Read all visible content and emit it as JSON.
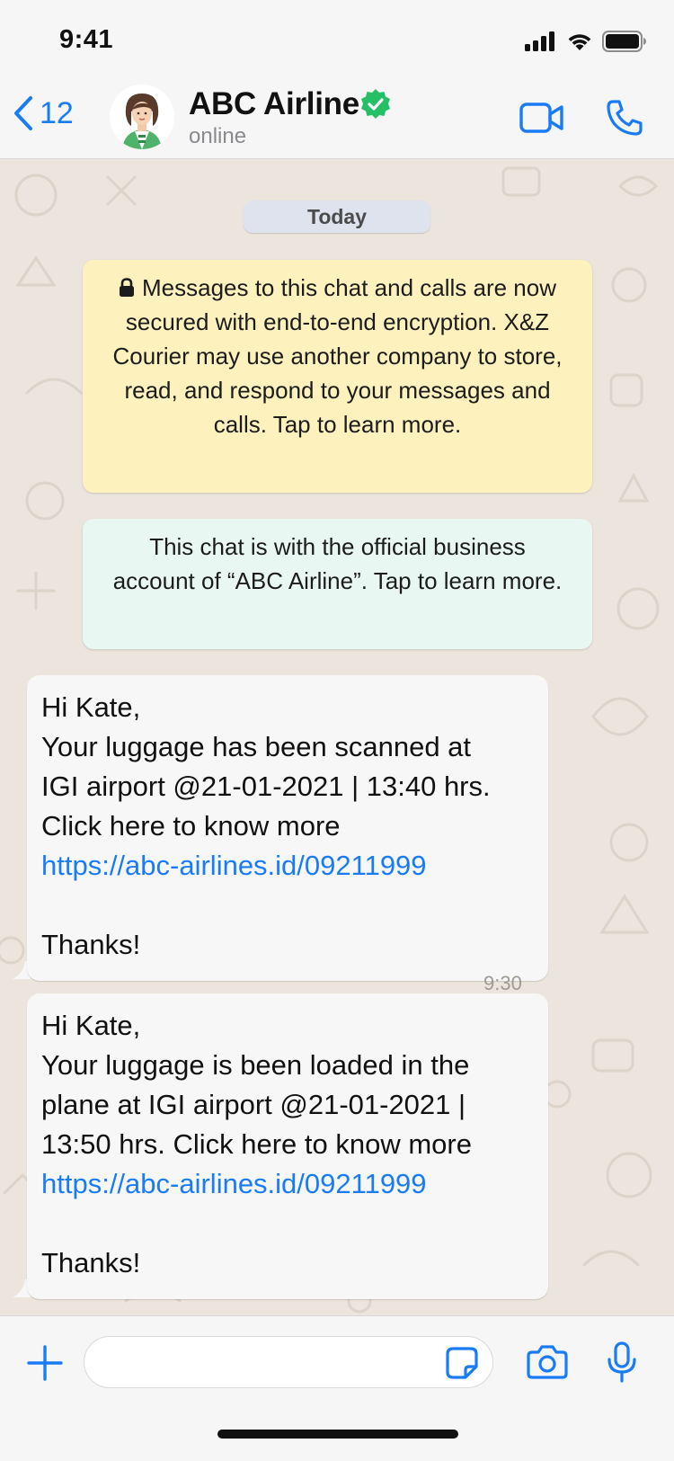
{
  "status_bar": {
    "time": "9:41"
  },
  "header": {
    "back_count": "12",
    "contact_name": "ABC Airline",
    "contact_status": "online"
  },
  "chat": {
    "date_label": "Today",
    "encryption_notice": "Messages to this chat and calls are now secured with end-to-end encryption. X&Z Courier may use another company to store, read, and respond to your messages and calls. Tap to learn more.",
    "business_notice": "This chat is with the official business account of “ABC Airline”. Tap to learn more.",
    "partial_time": "9:30",
    "messages": [
      {
        "greeting": "Hi Kate,",
        "body_lines": [
          "Your luggage has been scanned at",
          "IGI airport @21-01-2021 | 13:40 hrs.",
          "Click here to know more"
        ],
        "link": "https://abc-airlines.id/09211999",
        "closing": "Thanks!"
      },
      {
        "greeting": "Hi Kate,",
        "body_lines": [
          "Your luggage is been loaded in the",
          "plane at IGI airport @21-01-2021 |",
          "13:50 hrs. Click here to know more"
        ],
        "link": "https://abc-airlines.id/09211999",
        "closing": "Thanks!"
      }
    ]
  },
  "input": {
    "placeholder": ""
  },
  "icons": {
    "signal": "signal-icon",
    "wifi": "wifi-icon",
    "battery": "battery-icon",
    "back": "chevron-left-icon",
    "verified": "verified-badge-icon",
    "video": "video-call-icon",
    "phone": "phone-call-icon",
    "lock": "lock-icon",
    "plus": "plus-icon",
    "sticker": "sticker-icon",
    "camera": "camera-icon",
    "mic": "microphone-icon"
  },
  "colors": {
    "accent": "#1a7cf5",
    "verified": "#25c065",
    "encryption_notice_bg": "#fdf1be",
    "business_notice_bg": "#e9f7f2",
    "chat_bg": "#ece5dd",
    "bubble_bg": "#f7f7f7"
  }
}
